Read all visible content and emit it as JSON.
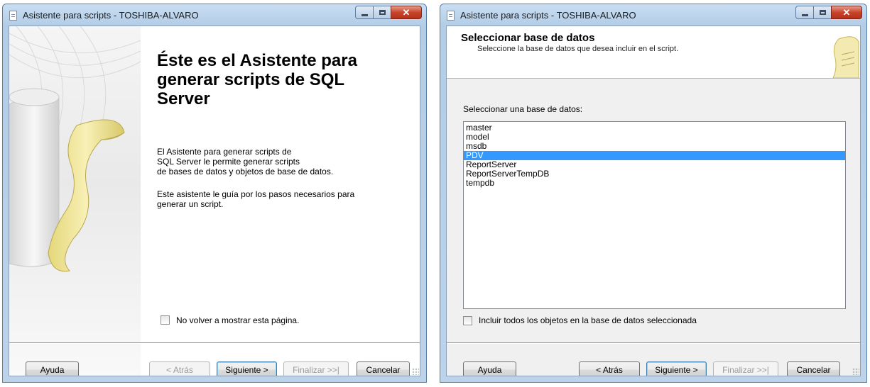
{
  "left": {
    "window_title": "Asistente para scripts - TOSHIBA-ALVARO",
    "heading": "Éste es el Asistente para generar scripts de SQL Server",
    "paragraph1_lines": [
      "El Asistente para generar scripts de",
      "SQL Server le permite generar scripts",
      "de bases de datos y objetos de base de datos."
    ],
    "paragraph2_lines": [
      "Este asistente le guía por los pasos necesarios para",
      "generar un script."
    ],
    "checkbox_label": "No volver a mostrar esta página.",
    "checkbox_checked": false,
    "buttons": {
      "help": "Ayuda",
      "back": "< Atrás",
      "next": "Siguiente >",
      "finish": "Finalizar >>|",
      "cancel": "Cancelar"
    }
  },
  "right": {
    "window_title": "Asistente para scripts - TOSHIBA-ALVARO",
    "header_title": "Seleccionar base de datos",
    "header_subtitle": "Seleccione la base de datos que desea incluir en el script.",
    "list_label": "Seleccionar una base de datos:",
    "databases": [
      "master",
      "model",
      "msdb",
      "PDV",
      "ReportServer",
      "ReportServerTempDB",
      "tempdb"
    ],
    "selected_database": "PDV",
    "checkbox_label": "Incluir todos los objetos en la base de datos seleccionada",
    "checkbox_checked": false,
    "buttons": {
      "help": "Ayuda",
      "back": "< Atrás",
      "next": "Siguiente >",
      "finish": "Finalizar >>|",
      "cancel": "Cancelar"
    }
  },
  "window_controls": {
    "minimize": "minimize-icon",
    "maximize": "maximize-icon",
    "close": "close-icon"
  },
  "colors": {
    "selection": "#3399ff",
    "close_button": "#c7442b",
    "default_button_border": "#3c7fb1"
  }
}
